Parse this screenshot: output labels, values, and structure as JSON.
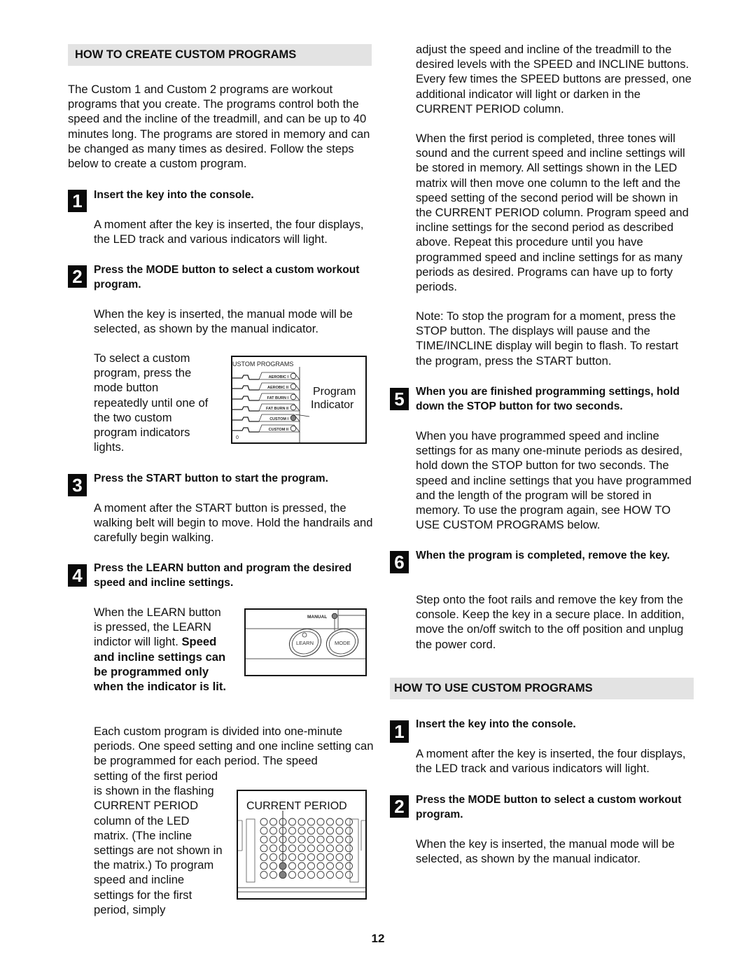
{
  "left_column": {
    "section_title": "HOW TO CREATE CUSTOM PROGRAMS",
    "intro": "The Custom 1 and Custom 2 programs are workout programs that you create. The programs control both the speed and the incline of the treadmill, and can be up to 40 minutes long. The programs are stored in memory and can be changed as many times as desired. Follow the steps below to create a custom program.",
    "steps": [
      {
        "number": "1",
        "title": "Insert the key into the console.",
        "body": "A moment after the key is inserted, the four displays, the LED track and various indicators will light."
      },
      {
        "number": "2",
        "title": "Press the MODE button to select a custom workout program.",
        "body": "When the key is inserted, the manual mode will be selected, as shown by the manual indicator.",
        "figure_text": "To select a custom program, press the mode button repeatedly until one of the two custom program indicators lights."
      },
      {
        "number": "3",
        "title": "Press the START button to start the program.",
        "body": "A moment after the START button is pressed, the walking belt will begin to move. Hold the handrails and carefully begin walking."
      },
      {
        "number": "4",
        "title": "Press the LEARN button and program the desired speed and incline settings.",
        "figure_text_normal": "When the LEARN button is pressed, the LEARN indictor will light.",
        "figure_text_bold": "Speed and incline settings can be programmed only when the indicator is lit.",
        "body_wide": "Each custom program is divided into one-minute periods. One speed setting and one incline setting can be programmed for each period. The speed",
        "body_narrow": "setting of the first period is shown in the flashing CURRENT PERIOD column of the LED matrix. (The incline settings are not shown in the matrix.) To program speed and incline settings for the first period, simply"
      }
    ]
  },
  "right_column": {
    "continued_1": "adjust the speed and incline of the treadmill to the desired levels with the SPEED and INCLINE buttons. Every few times the SPEED buttons are pressed, one additional indicator will light or darken in the CURRENT PERIOD column.",
    "continued_2": "When the first period is completed, three tones will sound and the current speed and incline settings will be stored in memory. All settings shown in the LED matrix will then move one column to the left and the speed setting of the second period will be shown in the CURRENT PERIOD column. Program speed and incline settings for the second period as described above. Repeat this procedure until you have programmed speed and incline settings for as many periods as desired. Programs can have up to forty periods.",
    "note": "Note: To stop the program for a moment, press the STOP button. The displays will pause and the TIME/INCLINE display will begin to flash. To restart the program, press the START button.",
    "steps": [
      {
        "number": "5",
        "title": "When you are finished programming settings, hold down the STOP button for two seconds.",
        "body": "When you have programmed speed and incline settings for as many one-minute periods as desired, hold down the STOP button for two seconds. The speed and incline settings that you have programmed and the length of the program will be stored in memory. To use the program again, see HOW TO USE CUSTOM PROGRAMS below."
      },
      {
        "number": "6",
        "title": "When the program is completed, remove the key.",
        "body": "Step onto the foot rails and remove the key from the console. Keep the key in a secure place. In addition, move the on/off switch to the off position and unplug the power cord."
      }
    ],
    "section2_title": "HOW TO USE CUSTOM PROGRAMS",
    "section2_steps": [
      {
        "number": "1",
        "title": "Insert the key into the console.",
        "body": "A moment after the key is inserted, the four displays, the LED track and various indicators will light."
      },
      {
        "number": "2",
        "title": "Press the MODE button to select a custom workout program.",
        "body": "When the key is inserted, the manual mode will be selected, as shown by the manual indicator."
      }
    ]
  },
  "figures": {
    "programs_panel": {
      "header": "USTOM PROGRAMS",
      "programs": [
        "AEROBIC I",
        "AEROBIC II",
        "FAT BURN I",
        "FAT BURN II",
        "CUSTOM I",
        "CUSTOM II"
      ],
      "lit_program": "CUSTOM I",
      "scale_label": "0",
      "callout_line1": "Program",
      "callout_line2": "Indicator"
    },
    "learn_panel": {
      "manual_label": "MANUAL",
      "learn_label": "LEARN",
      "mode_label": "MODE"
    },
    "led_matrix": {
      "title": "CURRENT PERIOD",
      "columns": 10,
      "rows": 7,
      "current_column": 3,
      "lit_leds_in_current_column": 2
    },
    "lit_color": "#808080"
  },
  "page_number": "12"
}
